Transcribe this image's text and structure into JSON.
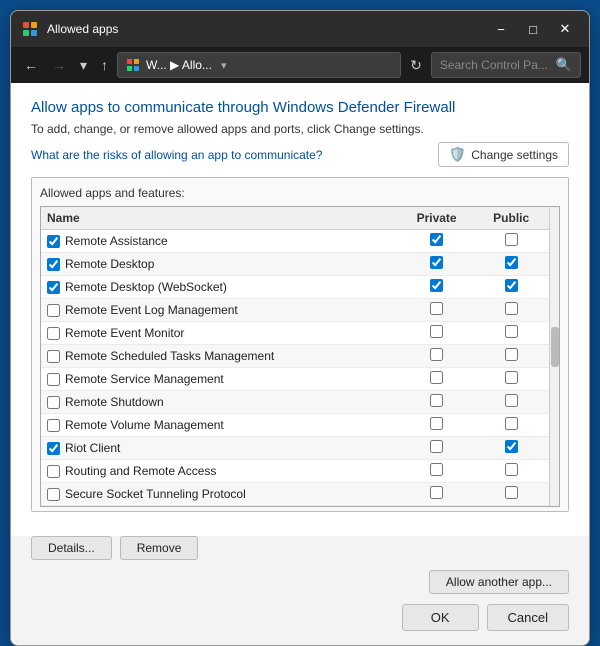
{
  "titlebar": {
    "title": "Allowed apps",
    "icon": "control-panel-icon",
    "minimize_label": "−",
    "maximize_label": "□",
    "close_label": "✕"
  },
  "navbar": {
    "back_label": "←",
    "forward_label": "→",
    "history_label": "▾",
    "up_label": "↑",
    "address": "W... ▶ Allo...",
    "refresh_label": "↻",
    "search_placeholder": "Search Control Pa..."
  },
  "page": {
    "title": "Allow apps to communicate through Windows Defender Firewall",
    "description": "To add, change, or remove allowed apps and ports, click Change settings.",
    "help_link": "What are the risks of allowing an app to communicate?",
    "change_settings_label": "Change settings",
    "table_label": "Allowed apps and features:",
    "columns": {
      "name": "Name",
      "private": "Private",
      "public": "Public"
    },
    "apps": [
      {
        "name": "Remote Assistance",
        "app_checked": true,
        "private": true,
        "public": false
      },
      {
        "name": "Remote Desktop",
        "app_checked": true,
        "private": true,
        "public": true
      },
      {
        "name": "Remote Desktop (WebSocket)",
        "app_checked": true,
        "private": true,
        "public": true
      },
      {
        "name": "Remote Event Log Management",
        "app_checked": false,
        "private": false,
        "public": false
      },
      {
        "name": "Remote Event Monitor",
        "app_checked": false,
        "private": false,
        "public": false
      },
      {
        "name": "Remote Scheduled Tasks Management",
        "app_checked": false,
        "private": false,
        "public": false
      },
      {
        "name": "Remote Service Management",
        "app_checked": false,
        "private": false,
        "public": false
      },
      {
        "name": "Remote Shutdown",
        "app_checked": false,
        "private": false,
        "public": false
      },
      {
        "name": "Remote Volume Management",
        "app_checked": false,
        "private": false,
        "public": false
      },
      {
        "name": "Riot Client",
        "app_checked": true,
        "private": false,
        "public": true
      },
      {
        "name": "Routing and Remote Access",
        "app_checked": false,
        "private": false,
        "public": false
      },
      {
        "name": "Secure Socket Tunneling Protocol",
        "app_checked": false,
        "private": false,
        "public": false
      }
    ],
    "details_btn": "Details...",
    "remove_btn": "Remove",
    "allow_another_btn": "Allow another app...",
    "ok_btn": "OK",
    "cancel_btn": "Cancel"
  }
}
